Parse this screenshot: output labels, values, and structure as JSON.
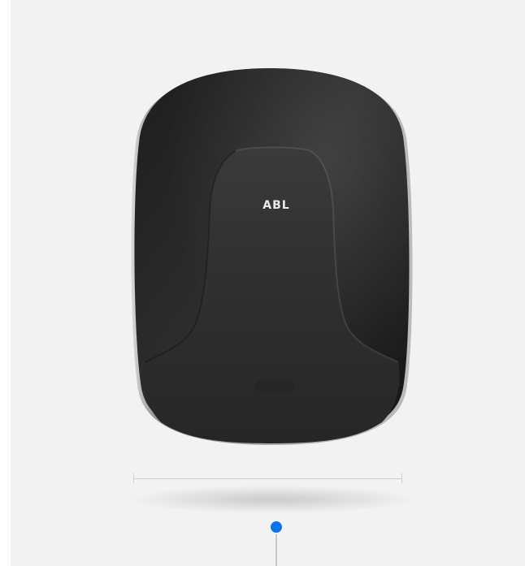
{
  "product": {
    "brand_label": "ABL",
    "body_color": "#2b2b2b",
    "panel_color": "#333333"
  },
  "background_color": "#f2f2f2",
  "hotspot": {
    "color": "#0a74f0"
  }
}
